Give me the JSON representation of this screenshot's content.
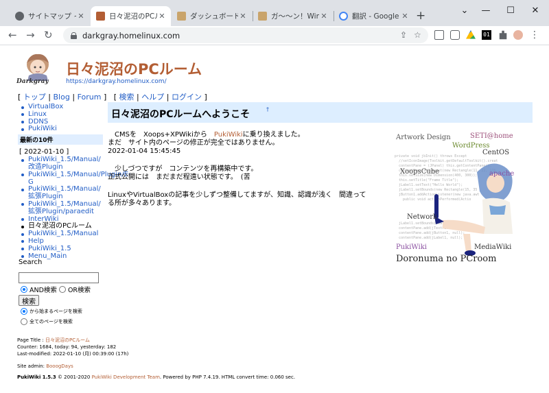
{
  "browser": {
    "tabs": [
      {
        "title": "サイトマップ ~ Sarasa",
        "favicon_color": "#5f6368",
        "active": false
      },
      {
        "title": "日々泥沼のPCルーム",
        "favicon_color": "#b35e34",
        "active": true
      },
      {
        "title": "ダッシュボード ‹ 泥沼",
        "favicon_color": "#c9a46b",
        "active": false
      },
      {
        "title": "ガ〜〜ン！Windows",
        "favicon_color": "#c9a46b",
        "active": false
      },
      {
        "title": "翻訳 - Google 検索",
        "favicon_color": "#4285f4",
        "active": false
      }
    ],
    "new_tab_label": "+",
    "url": "darkgray.homelinux.com"
  },
  "site": {
    "title": "日々泥沼のPCルーム",
    "url": "https://darkgray.homelinux.com/",
    "logo_label": "Darkgray"
  },
  "navbar": {
    "open": "[",
    "top": "トップ",
    "blog": "Blog",
    "forum": "Forum",
    "close": "]",
    "open2": "[",
    "search": "検索",
    "help": "ヘルプ",
    "login": "ログイン",
    "close2": "]",
    "sep": "|"
  },
  "menubar": {
    "top_links": [
      "VirtualBox",
      "Linux",
      "DDNS",
      "PukiWiki"
    ],
    "recent_heading": "最新の10件",
    "recent_date": "[ 2022-01-10 ]",
    "recent_links": [
      "PukiWiki_1.5/Manual/改造Plugin",
      "PukiWiki_1.5/Manual/Plugin/E-G",
      "PukiWiki_1.5/Manual/拡張Plugin",
      "PukiWiki_1.5/Manual/拡張Plugin/paraedit",
      "InterWiki",
      "日々泥沼のPCルーム",
      "PukiWiki_1.5/Manual",
      "Help",
      "PukiWiki_1.5",
      "Menu_Main"
    ]
  },
  "search": {
    "title": "Search",
    "value": "",
    "and_label": "AND検索",
    "or_label": "OR検索",
    "button": "検索",
    "prefix_label": "から始まるページを検索",
    "all_label": "全てのページを検索"
  },
  "main": {
    "title": "日々泥沼のPCルームへようこそ",
    "anchor": "†",
    "para1_line1_pre": "　CMSを　Xoops+XPWikiから　",
    "para1_link": "PukiWiki",
    "para1_line1_post": "に乗り換えました。",
    "para1_line2": "まだ　サイト内のページの修正が完全ではありません。",
    "para1_line3": "2022-01-04 15:45:45",
    "para2_line1": "　少しづつですが　コンテンツを再構築中です。",
    "para2_line2": "正式公開には　まだまだ程遠い状態です。　(苦",
    "para3_line1": "LinuxやVirtualBoxの記事を少しずつ整備してますが、知識、認識が浅く　間違って",
    "para3_line2": "る所が多々あります。"
  },
  "collage": {
    "words": [
      "Artwork Design",
      "SETI@home",
      "WordPress",
      "XoopsCube",
      "CentOS",
      "apache",
      "Network",
      "PukiWiki",
      "MediaWiki",
      "Doronuma no PCroom"
    ]
  },
  "footer": {
    "page_title_label": "Page Title :",
    "page_title": "日々泥沼のPCルーム",
    "counter": "Counter: 1684, today: 94, yesterday: 182",
    "last_modified": "Last-modified: 2022-01-10 (月) 00:39:00 (17h)",
    "admin_label": "Site admin:",
    "admin_name": "BooogDays",
    "powered_pre": "PukiWiki 1.5.3",
    "powered_mid": "© 2001-2020",
    "powered_link": "PukiWiki Development Team",
    "powered_post": ". Powered by PHP 7.4.19. HTML convert time: 0.060 sec."
  }
}
